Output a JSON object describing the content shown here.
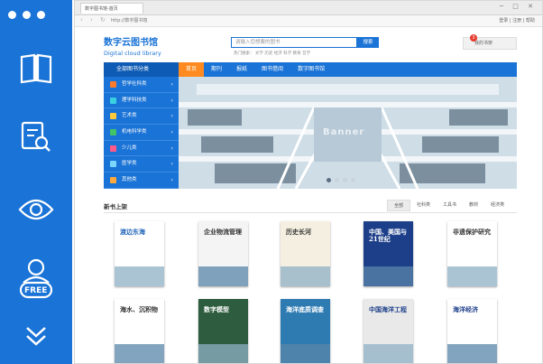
{
  "window": {
    "tab_title": "数字图书馆-首页",
    "address": "http://数字图书馆",
    "top_links": "登录 | 注册 | 帮助"
  },
  "header": {
    "logo_cn": "数字云图书馆",
    "logo_en": "Digital cloud library",
    "search_placeholder": "请输入您想要的图书",
    "search_button": "搜索",
    "hot_words": "热门搜索：  文学  历史  经济  科学  教育  哲学",
    "myshelf": "我的书架",
    "badge": "3"
  },
  "nav": {
    "category_head": "全部图书分类",
    "items": [
      "首页",
      "期刊",
      "报纸",
      "图书借阅",
      "数字图书馆"
    ]
  },
  "categories": [
    {
      "label": "哲学社科类",
      "color": "#ff7b2c"
    },
    {
      "label": "理学科技类",
      "color": "#3ad0e0"
    },
    {
      "label": "艺术类",
      "color": "#ffc93c"
    },
    {
      "label": "机电科学类",
      "color": "#41c466"
    },
    {
      "label": "少儿类",
      "color": "#ff5a8a"
    },
    {
      "label": "医学类",
      "color": "#7bd6ff"
    },
    {
      "label": "其他类",
      "color": "#ffa93c"
    }
  ],
  "banner": {
    "text": "Banner"
  },
  "new_books": {
    "title": "新书上架",
    "filters": [
      "全部",
      "社科类",
      "工具书",
      "教材",
      "经济类"
    ]
  },
  "books": [
    {
      "title": "渡边东海",
      "bg": "#ffffff",
      "fg": "#2266b8"
    },
    {
      "title": "企业物流管理",
      "bg": "#f4f4f4",
      "fg": "#333333"
    },
    {
      "title": "历史长河",
      "bg": "#f4efe0",
      "fg": "#333333"
    },
    {
      "title": "中国、美国与21世纪",
      "bg": "#1d3f8a",
      "fg": "#ffffff"
    },
    {
      "title": "非遗保护研究",
      "bg": "#ffffff",
      "fg": "#333333"
    },
    {
      "title": "海水、沉积物",
      "bg": "#ffffff",
      "fg": "#333333"
    },
    {
      "title": "数字模型",
      "bg": "#2e5c3e",
      "fg": "#ffffff"
    },
    {
      "title": "海洋底质调查",
      "bg": "#2e7bb2",
      "fg": "#ffffff"
    },
    {
      "title": "中国海洋工程",
      "bg": "#e9e9e9",
      "fg": "#1d3f8a"
    },
    {
      "title": "海洋经济",
      "bg": "#ffffff",
      "fg": "#1d3f8a"
    }
  ],
  "icons": [
    "book-open-icon",
    "search-document-icon",
    "eye-icon",
    "user-free-icon",
    "chevron-double-down-icon"
  ],
  "icon_labels": {
    "free": "FREE"
  }
}
